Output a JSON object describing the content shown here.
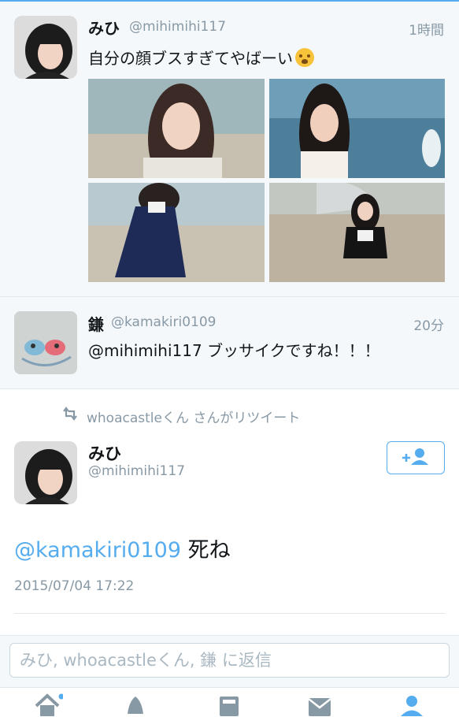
{
  "timeline": {
    "tweets": [
      {
        "name": "みひ",
        "handle": "@mihimihi117",
        "time": "1時間",
        "text": "自分の顔ブスすぎてやばーい",
        "emoji_icon": "crying-face-emoji",
        "photo_count": 4
      },
      {
        "name": "鎌",
        "handle": "@kamakiri0109",
        "time": "20分",
        "text": "@mihimihi117 ブッサイクですね！！！"
      }
    ]
  },
  "detail": {
    "retweet_label": "whoacastleくん さんがリツイート",
    "name": "みひ",
    "handle": "@mihimihi117",
    "follow_icon": "add-user-icon",
    "mention": "@kamakiri0109",
    "body": " 死ね",
    "date": "2015/07/04 17:22"
  },
  "reply": {
    "placeholder": "みひ, whoacastleくん, 鎌 に返信"
  },
  "tabbar": {
    "items": [
      {
        "icon": "home-icon",
        "has_badge": true
      },
      {
        "icon": "notifications-icon"
      },
      {
        "icon": "discover-icon"
      },
      {
        "icon": "messages-icon"
      },
      {
        "icon": "me-icon",
        "active": true
      }
    ]
  },
  "colors": {
    "accent": "#55acee",
    "text": "#14171a",
    "secondary": "#8899a6",
    "background": "#f5f8fa"
  }
}
